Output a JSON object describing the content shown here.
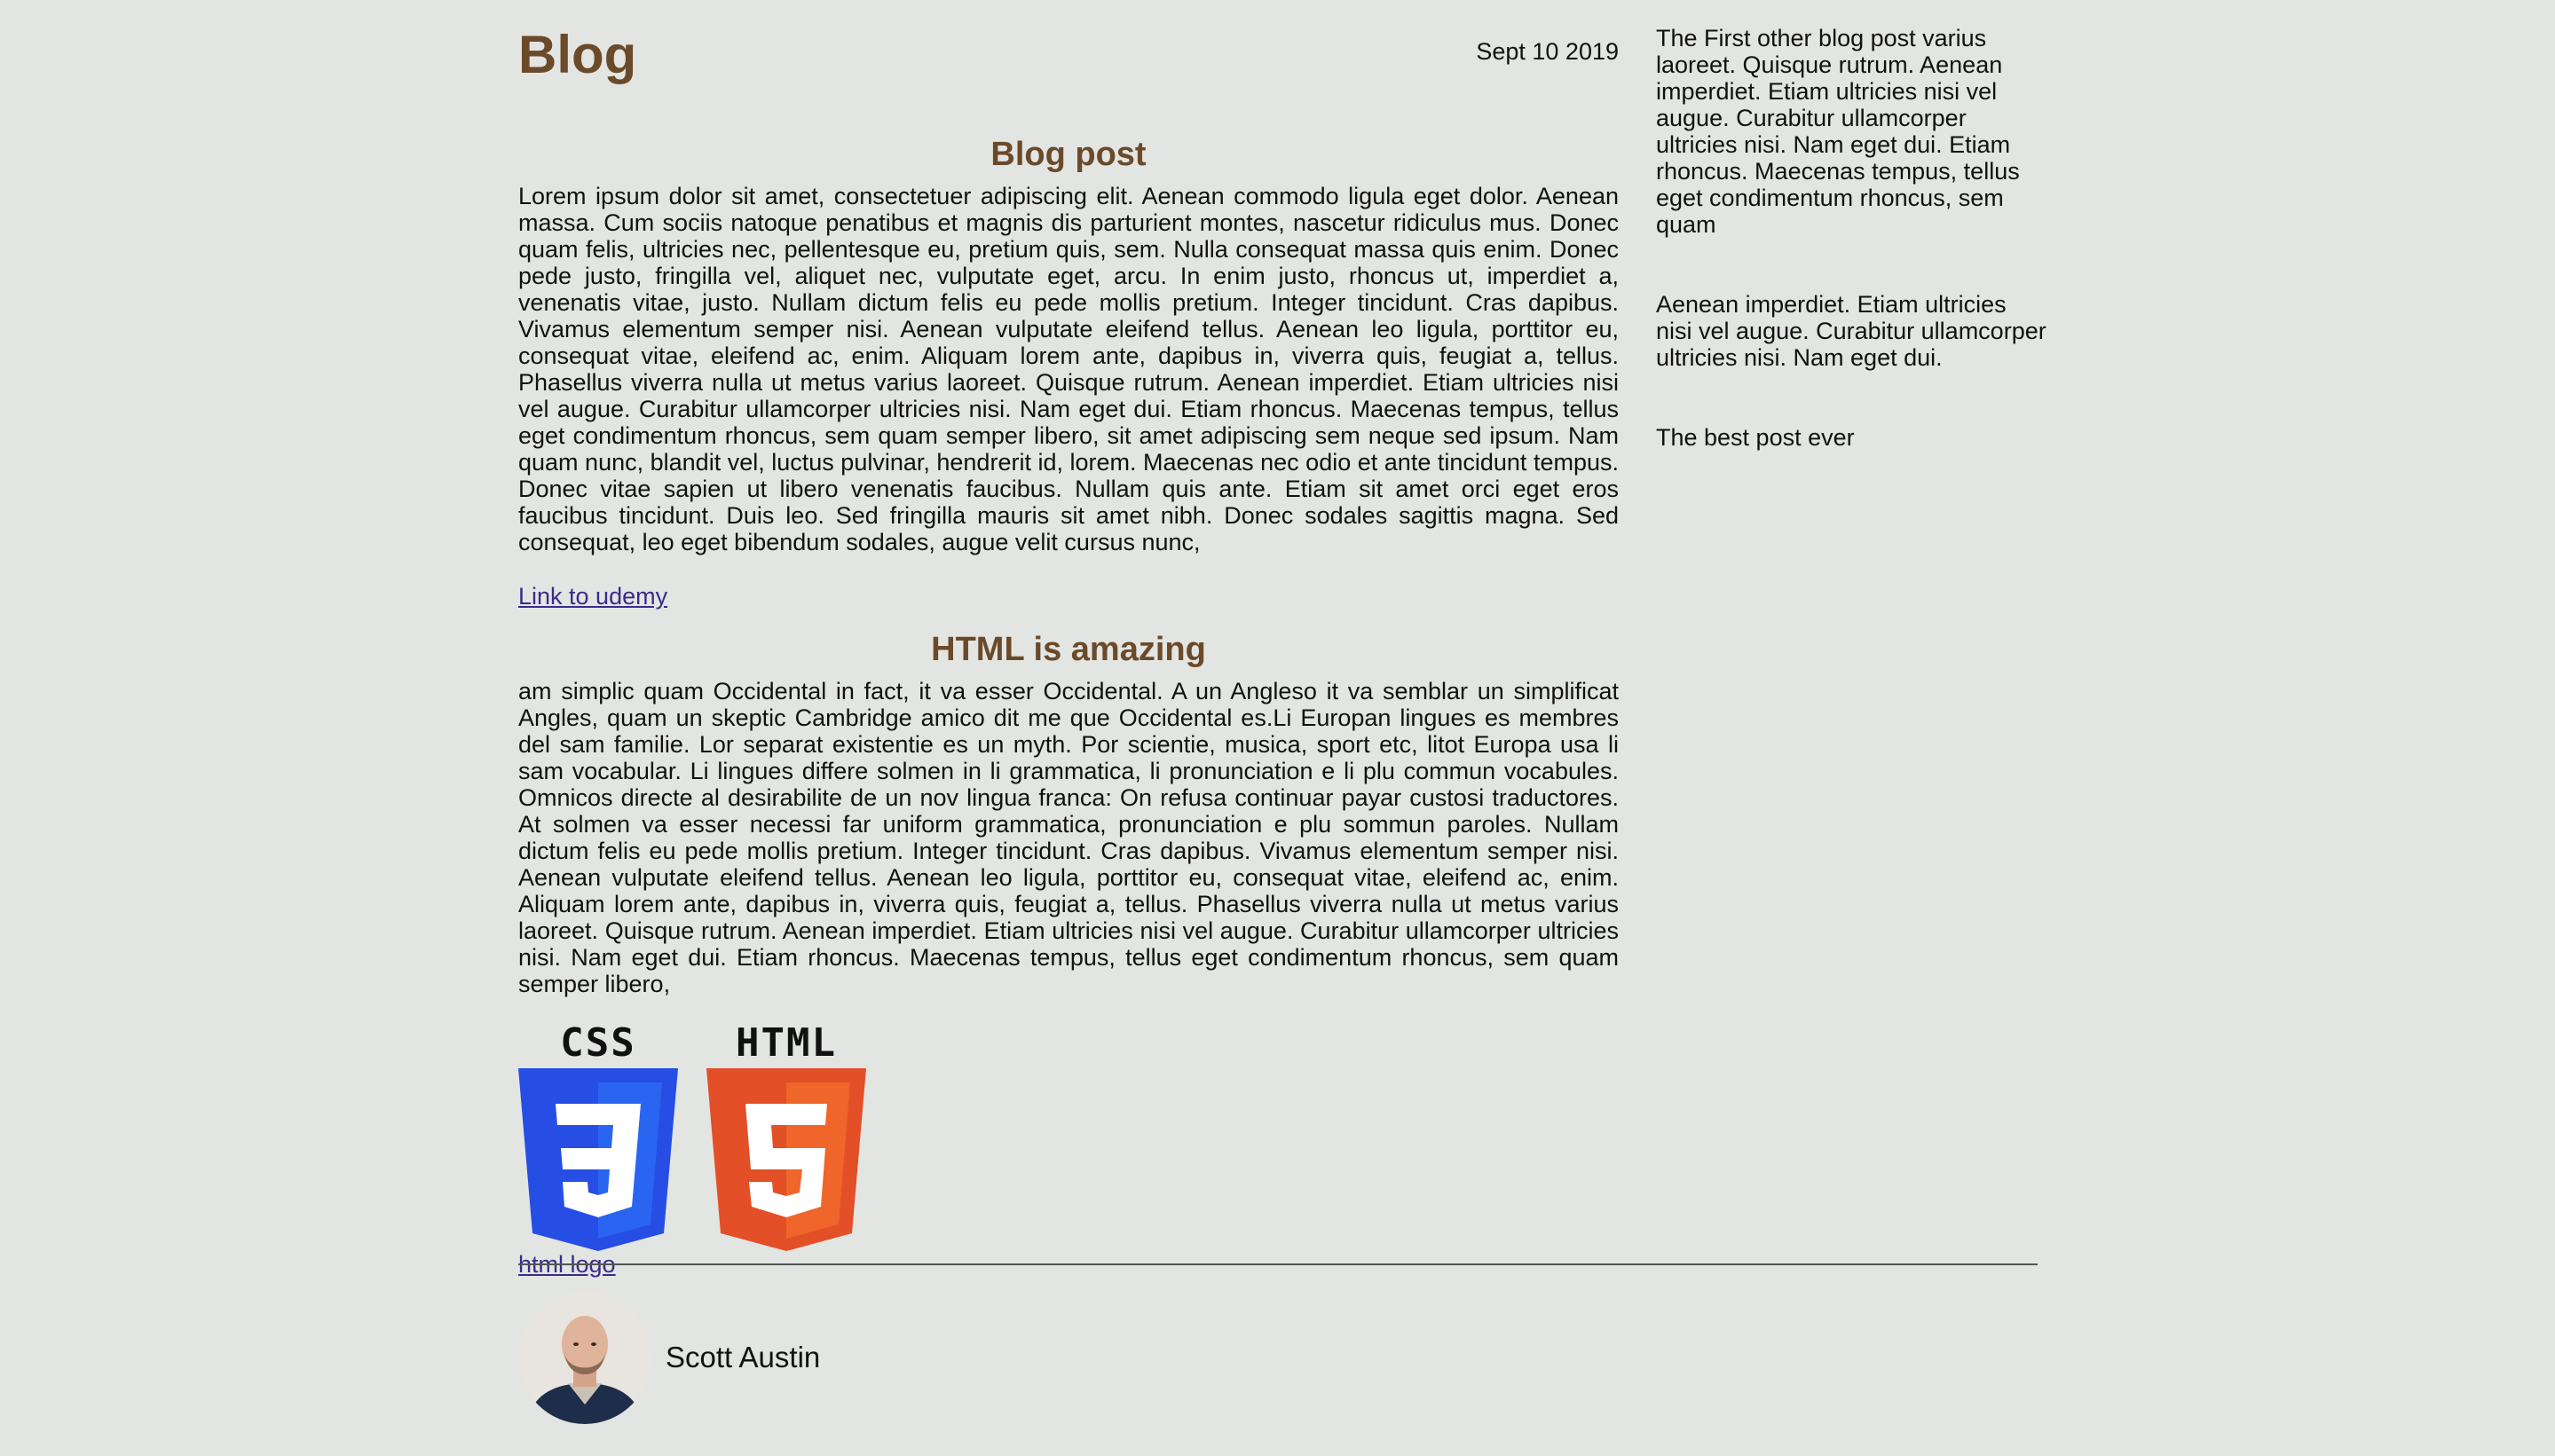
{
  "header": {
    "title": "Blog",
    "date": "Sept 10 2019"
  },
  "post1": {
    "title": "Blog post",
    "body": "Lorem ipsum dolor sit amet, consectetuer adipiscing elit. Aenean commodo ligula eget dolor. Aenean massa. Cum sociis natoque penatibus et magnis dis parturient montes, nascetur ridiculus mus. Donec quam felis, ultricies nec, pellentesque eu, pretium quis, sem. Nulla consequat massa quis enim. Donec pede justo, fringilla vel, aliquet nec, vulputate eget, arcu. In enim justo, rhoncus ut, imperdiet a, venenatis vitae, justo. Nullam dictum felis eu pede mollis pretium. Integer tincidunt. Cras dapibus. Vivamus elementum semper nisi. Aenean vulputate eleifend tellus. Aenean leo ligula, porttitor eu, consequat vitae, eleifend ac, enim. Aliquam lorem ante, dapibus in, viverra quis, feugiat a, tellus. Phasellus viverra nulla ut metus varius laoreet. Quisque rutrum. Aenean imperdiet. Etiam ultricies nisi vel augue. Curabitur ullamcorper ultricies nisi. Nam eget dui. Etiam rhoncus. Maecenas tempus, tellus eget condimentum rhoncus, sem quam semper libero, sit amet adipiscing sem neque sed ipsum. Nam quam nunc, blandit vel, luctus pulvinar, hendrerit id, lorem. Maecenas nec odio et ante tincidunt tempus. Donec vitae sapien ut libero venenatis faucibus. Nullam quis ante. Etiam sit amet orci eget eros faucibus tincidunt. Duis leo. Sed fringilla mauris sit amet nibh. Donec sodales sagittis magna. Sed consequat, leo eget bibendum sodales, augue velit cursus nunc,",
    "link_label": "Link to udemy"
  },
  "post2": {
    "title": "HTML is amazing",
    "body": "am simplic quam Occidental in fact, it va esser Occidental. A un Angleso it va semblar un simplificat Angles, quam un skeptic Cambridge amico dit me que Occidental es.Li Europan lingues es membres del sam familie. Lor separat existentie es un myth. Por scientie, musica, sport etc, litot Europa usa li sam vocabular. Li lingues differe solmen in li grammatica, li pronunciation e li plu commun vocabules. Omnicos directe al desirabilite de un nov lingua franca: On refusa continuar payar custosi traductores. At solmen va esser necessi far uniform grammatica, pronunciation e plu sommun paroles. Nullam dictum felis eu pede mollis pretium. Integer tincidunt. Cras dapibus. Vivamus elementum semper nisi. Aenean vulputate eleifend tellus. Aenean leo ligula, porttitor eu, consequat vitae, eleifend ac, enim. Aliquam lorem ante, dapibus in, viverra quis, feugiat a, tellus. Phasellus viverra nulla ut metus varius laoreet. Quisque rutrum. Aenean imperdiet. Etiam ultricies nisi vel augue. Curabitur ullamcorper ultricies nisi. Nam eget dui. Etiam rhoncus. Maecenas tempus, tellus eget condimentum rhoncus, sem quam semper libero,",
    "logos": [
      {
        "word": "CSS",
        "digit": "3",
        "icon": "css3-shield-icon",
        "color": "#264de4",
        "color_light": "#2965f1"
      },
      {
        "word": "HTML",
        "digit": "5",
        "icon": "html5-shield-icon",
        "color": "#e34f26",
        "color_light": "#ef652a"
      }
    ],
    "logo_link_label": "html logo"
  },
  "sidebar": {
    "items": [
      {
        "text": "The First other blog post varius laoreet. Quisque rutrum. Aenean imperdiet. Etiam ultricies nisi vel augue. Curabitur ullamcorper ultricies nisi. Nam eget dui. Etiam rhoncus. Maecenas tempus, tellus eget condimentum rhoncus, sem quam"
      },
      {
        "text": "Aenean imperdiet. Etiam ultricies nisi vel augue. Curabitur ullamcorper ultricies nisi. Nam eget dui."
      },
      {
        "text": "The best post ever"
      }
    ]
  },
  "author": {
    "name": "Scott Austin",
    "avatar_icon": "person-avatar-icon"
  },
  "colors": {
    "background": "#e3e5e2",
    "heading": "#6b4a2a",
    "link": "#3b2a8c"
  }
}
